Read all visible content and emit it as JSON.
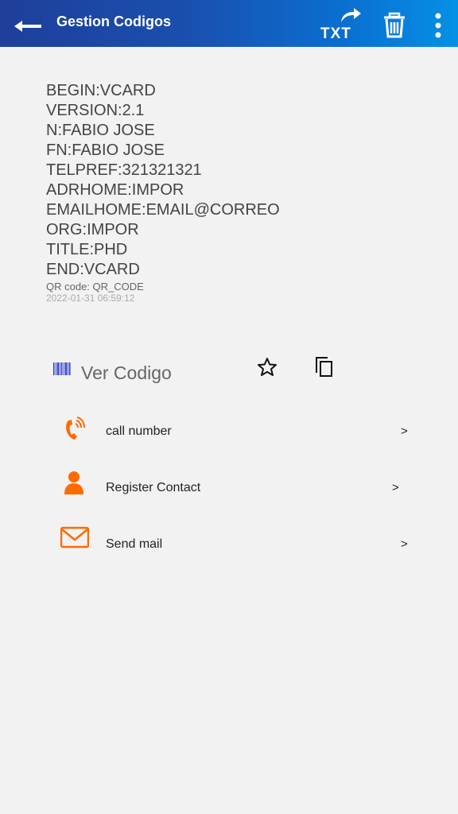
{
  "appbar": {
    "title": "Gestion Codigos",
    "back_icon": "arrow-left-icon",
    "txt_label": "TXT",
    "share_icon": "share-arrow-icon",
    "delete_icon": "trash-icon",
    "menu_icon": "more-vertical-icon"
  },
  "vcard": {
    "lines": [
      "BEGIN:VCARD",
      "VERSION:2.1",
      "N:FABIO JOSE",
      "FN:FABIO JOSE",
      "TELPREF:321321321",
      "ADRHOME:IMPOR",
      "EMAILHOME:EMAIL@CORREO",
      "ORG:IMPOR",
      "TITLE:PHD",
      "END:VCARD"
    ],
    "qr_type": "QR code: QR_CODE",
    "timestamp": "2022-01-31 06:59:12"
  },
  "code_row": {
    "label": "Ver Codigo",
    "barcode_icon": "barcode-icon",
    "favorite_icon": "star-icon",
    "copy_icon": "copy-icon"
  },
  "actions": [
    {
      "label": "call number",
      "icon": "phone-icon",
      "chevron": ">"
    },
    {
      "label": "Register Contact",
      "icon": "person-icon",
      "chevron": ">"
    },
    {
      "label": "Send mail",
      "icon": "mail-icon",
      "chevron": ">"
    }
  ],
  "colors": {
    "appbar_start": "#1e3f9a",
    "appbar_end": "#0590e6",
    "accent_orange": "#ff6a00",
    "barcode_blue": "#2233cc",
    "background": "#f2f2f2"
  }
}
